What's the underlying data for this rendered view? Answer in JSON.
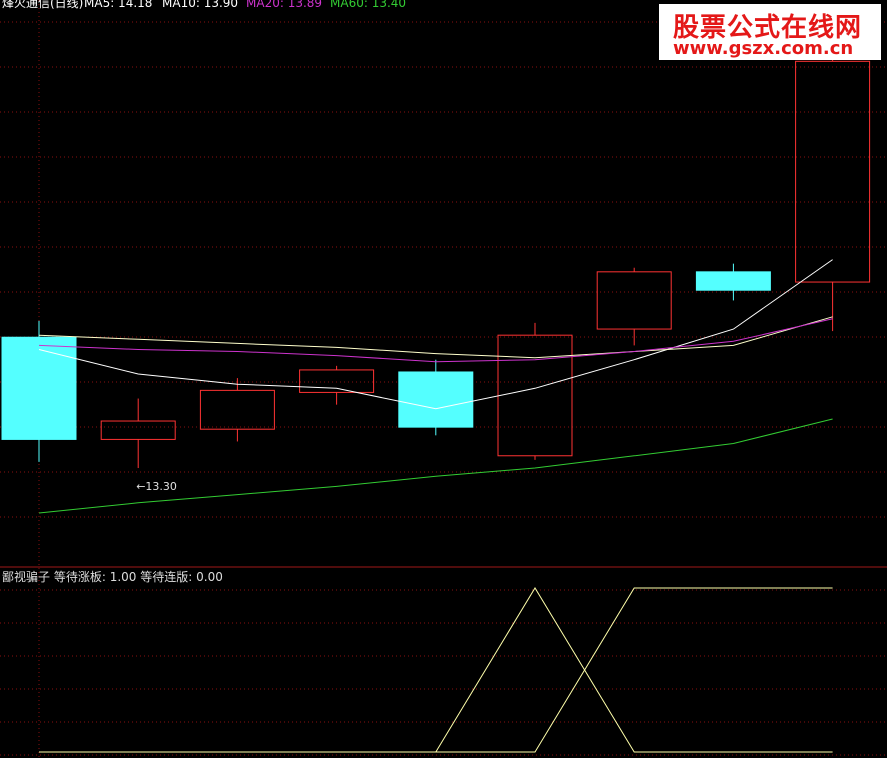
{
  "header": {
    "title": "烽火通信(日线)",
    "ma": [
      {
        "label": "MA5: 14.18",
        "color": "#ffffff"
      },
      {
        "label": "MA10: 13.90",
        "color": "#ffffff"
      },
      {
        "label": "MA20: 13.89",
        "color": "#cc33cc"
      },
      {
        "label": "MA60: 13.40",
        "color": "#33cc33"
      }
    ]
  },
  "logo": {
    "line1": "股票公式在线网",
    "line2": "www.gszx.com.cn"
  },
  "sub_header": {
    "name": "鄙视骗子",
    "wait_limit_label": "等待涨板:",
    "wait_limit_value": "1.00",
    "wait_board_label": "等待连版:",
    "wait_board_value": "0.00"
  },
  "colors": {
    "up": "#ff3333",
    "down": "#54ffff",
    "grid": "#8a1010",
    "divider": "#a01818"
  },
  "chart_data": [
    {
      "type": "candlestick",
      "price_range": [
        12.71,
        15.45
      ],
      "candles": [
        {
          "open": 13.8,
          "high": 13.88,
          "low": 13.19,
          "close": 13.3,
          "dir": "down"
        },
        {
          "open": 13.3,
          "high": 13.5,
          "low": 13.16,
          "close": 13.39,
          "dir": "up"
        },
        {
          "open": 13.35,
          "high": 13.6,
          "low": 13.29,
          "close": 13.54,
          "dir": "up"
        },
        {
          "open": 13.53,
          "high": 13.66,
          "low": 13.47,
          "close": 13.64,
          "dir": "up"
        },
        {
          "open": 13.63,
          "high": 13.69,
          "low": 13.32,
          "close": 13.36,
          "dir": "down"
        },
        {
          "open": 13.22,
          "high": 13.87,
          "low": 13.2,
          "close": 13.81,
          "dir": "up"
        },
        {
          "open": 13.84,
          "high": 14.14,
          "low": 13.76,
          "close": 14.12,
          "dir": "up"
        },
        {
          "open": 14.12,
          "high": 14.16,
          "low": 13.98,
          "close": 14.03,
          "dir": "down"
        },
        {
          "open": 14.07,
          "high": 15.4,
          "low": 13.83,
          "close": 15.15,
          "dir": "up"
        }
      ],
      "ma_series": [
        {
          "name": "MA5",
          "color": "#ffffff",
          "values": [
            13.74,
            13.62,
            13.57,
            13.55,
            13.45,
            13.55,
            13.69,
            13.84,
            14.18
          ]
        },
        {
          "name": "MA10",
          "color": "#ffffcc",
          "values": [
            13.81,
            13.79,
            13.77,
            13.75,
            13.72,
            13.7,
            13.73,
            13.76,
            13.9
          ]
        },
        {
          "name": "MA20",
          "color": "#cc33cc",
          "values": [
            13.76,
            13.74,
            13.73,
            13.71,
            13.68,
            13.69,
            13.73,
            13.78,
            13.89
          ]
        },
        {
          "name": "MA60",
          "color": "#33cc33",
          "values": [
            12.94,
            12.99,
            13.03,
            13.07,
            13.12,
            13.16,
            13.22,
            13.28,
            13.4
          ]
        }
      ],
      "low_annotation": {
        "label": "←13.30"
      }
    },
    {
      "type": "line",
      "name": "鄙视骗子",
      "y_range": [
        0,
        1
      ],
      "series": [
        {
          "name": "等待涨板",
          "color": "#ffffaa",
          "values": [
            0,
            0,
            0,
            0,
            0,
            1,
            0,
            0,
            0
          ]
        },
        {
          "name": "等待连版",
          "color": "#ffffaa",
          "values": [
            0,
            0,
            0,
            0,
            0,
            0,
            1,
            1,
            1
          ]
        }
      ]
    }
  ]
}
